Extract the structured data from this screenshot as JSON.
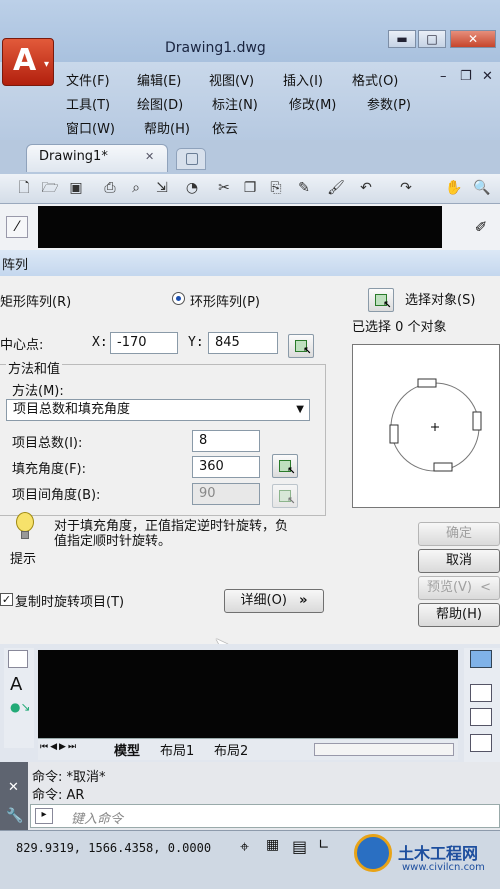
{
  "window": {
    "title": "Drawing1.dwg",
    "controls": {
      "minimize": "▬",
      "maximize": "□",
      "close": "✕"
    },
    "mdi_controls": {
      "minimize": "–",
      "restore": "❐",
      "close": "✕"
    }
  },
  "app_button": {
    "letter": "A",
    "caret": "▾"
  },
  "menu": {
    "row1": [
      "文件(F)",
      "编辑(E)",
      "视图(V)",
      "插入(I)",
      "格式(O)"
    ],
    "row2": [
      "工具(T)",
      "绘图(D)",
      "标注(N)",
      "修改(M)",
      "参数(P)"
    ],
    "row3": [
      "窗口(W)",
      "帮助(H)",
      "依云"
    ]
  },
  "tabs": {
    "active": "Drawing1*",
    "close": "✕"
  },
  "toolbar_icons": [
    "new-icon",
    "open-icon",
    "save-icon",
    "print-icon",
    "preview-icon",
    "publish-icon",
    "plot-icon",
    "cut-icon",
    "copy-icon",
    "paste-icon",
    "matchprop-icon",
    "brush-icon",
    "undo-icon",
    "redo-icon",
    "pan-icon",
    "zoom-icon"
  ],
  "dialog": {
    "title": "阵列",
    "rect_array": "矩形阵列(R)",
    "polar_array": "环形阵列(P)",
    "select_objects": "选择对象(S)",
    "selected_count": "已选择 0 个对象",
    "center_label": "中心点:",
    "x_label": "X:",
    "x_value": "-170",
    "y_label": "Y:",
    "y_value": "845",
    "method_group": "方法和值",
    "method_label": "方法(M):",
    "method_value": "项目总数和填充角度",
    "total_label": "项目总数(I):",
    "total_value": "8",
    "fill_label": "填充角度(F):",
    "fill_value": "360",
    "between_label": "项目间角度(B):",
    "between_value": "90",
    "tip_text_line1": "对于填充角度，正值指定逆时针旋转，负",
    "tip_text_line2": "值指定顺时针旋转。",
    "tip_label": "提示",
    "rotate_items": "复制时旋转项目(T)",
    "details": "详细(O)",
    "details_arrow": "»",
    "ok": "确定",
    "cancel": "取消",
    "preview": "预览(V)",
    "preview_arrow": "<",
    "help": "帮助(H)"
  },
  "layout_tabs": {
    "model": "模型",
    "layout1": "布局1",
    "layout2": "布局2"
  },
  "command": {
    "line1": "命令: *取消*",
    "line2": "命令: AR",
    "placeholder": "键入命令"
  },
  "status": {
    "coords": "829.9319, 1566.4358, 0.0000"
  },
  "logo": {
    "name": "土木工程网",
    "url": "www.civilcn.com"
  }
}
